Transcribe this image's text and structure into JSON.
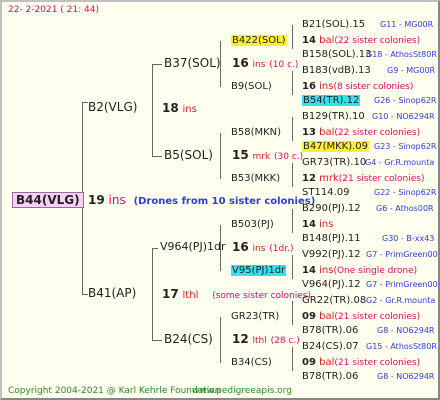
{
  "header": "22-  2-2021  ( 21: 44)",
  "footer_left": "Copyright 2004-2021 @ Karl Kehrle Foundation",
  "footer_right": "www.pedigreeapis.org",
  "root": {
    "name": "B44(VLG)",
    "num": "19",
    "unit": "ins",
    "note": "(Drones from 10 sister colonies)"
  },
  "gen1": [
    {
      "name": "B2(VLG)",
      "num": "18",
      "unit": "ins"
    },
    {
      "name": "B41(AP)",
      "num": "17",
      "unit": "lthl",
      "note": "(some sister colonies)"
    }
  ],
  "gen2": [
    {
      "name": "B37(SOL)",
      "num": "16",
      "unit": "ins",
      "note": "(10 c.)"
    },
    {
      "name": "B5(SOL)",
      "num": "15",
      "unit": "mrk",
      "note": "(30 c.)"
    },
    {
      "name": "V964(PJ)1dr",
      "num": "16",
      "unit": "ins",
      "note": "(1dr.)"
    },
    {
      "name": "B24(CS)",
      "num": "12",
      "unit": "lthl",
      "note": "(28 c.)"
    }
  ],
  "gen3": [
    {
      "name": "B422(SOL)",
      "num": "14",
      "unit": "bal",
      "note": "(22 sister colonies)"
    },
    {
      "name": "B9(SOL)",
      "num": "16",
      "unit": "ins",
      "note": "(8 sister colonies)"
    },
    {
      "name": "B58(MKN)",
      "num": "13",
      "unit": "bal",
      "note": "(22 sister colonies)"
    },
    {
      "name": "B53(MKK)",
      "num": "12",
      "unit": "mrk",
      "note": "(21 sister colonies)"
    },
    {
      "name": "B503(PJ)",
      "num": "14",
      "unit": "ins",
      "note": ""
    },
    {
      "name": "V95(PJ)1dr",
      "num": "14",
      "unit": "ins",
      "note": "(One single drone)"
    },
    {
      "name": "GR23(TR)",
      "num": "09",
      "unit": "bal",
      "note": "(21 sister colonies)"
    },
    {
      "name": "B34(CS)",
      "num": "09",
      "unit": "bal",
      "note": "(21 sister colonies)"
    }
  ],
  "gen4": [
    {
      "name": "B21(SOL).15",
      "ref": "G11 - MG00R"
    },
    {
      "name": "B158(SOL).13",
      "ref": "G18 - AthosSt80R"
    },
    {
      "name": "B183(vdB).13",
      "ref": "G9 - MG00R"
    },
    {
      "name": "B54(TR).12",
      "ref": "G26 - Sinop62R"
    },
    {
      "name": "B129(TR).10",
      "ref": "G10 - NO6294R"
    },
    {
      "name": "B47(MKK).09",
      "ref": "G23 - Sinop62R"
    },
    {
      "name": "GR73(TR).10",
      "ref": "G4 - Gr.R.mounta"
    },
    {
      "name": "ST114.09",
      "ref": "G22 - Sinop62R"
    },
    {
      "name": "B290(PJ).12",
      "ref": "G6 - Athos00R"
    },
    {
      "name": "B148(PJ).11",
      "ref": "G30 - B-xx43"
    },
    {
      "name": "V992(PJ).12",
      "ref": "G7 - PrimGreen00"
    },
    {
      "name": "V964(PJ).12",
      "ref": "G7 - PrimGreen00"
    },
    {
      "name": "GR22(TR).08",
      "ref": "G2 - Gr.R.mounta"
    },
    {
      "name": "B78(TR).06",
      "ref": "G8 - NO6294R"
    },
    {
      "name": "B24(CS).07",
      "ref": "G15 - AthosSt80R"
    },
    {
      "name": "B78(TR).06",
      "ref": "G8 - NO6294R"
    }
  ]
}
